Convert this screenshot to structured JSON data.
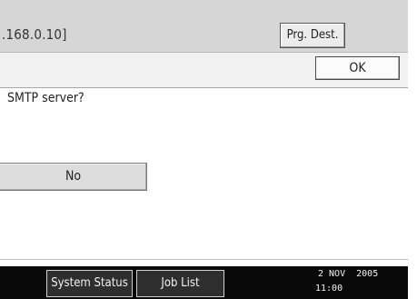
{
  "header": {
    "address": ".168.0.10]",
    "prg_dest_label": "Prg. Dest."
  },
  "dialog": {
    "ok_label": "OK",
    "question": "SMTP server?",
    "no_label": "No"
  },
  "status_bar": {
    "system_status_label": "System Status",
    "job_list_label": "Job List",
    "date": "2 NOV  2005",
    "time": "11:00"
  },
  "colors": {
    "header_background": "#d6d6d6",
    "status_bar_background": "#0a0a0a",
    "button_face": "#dcdcdc"
  }
}
